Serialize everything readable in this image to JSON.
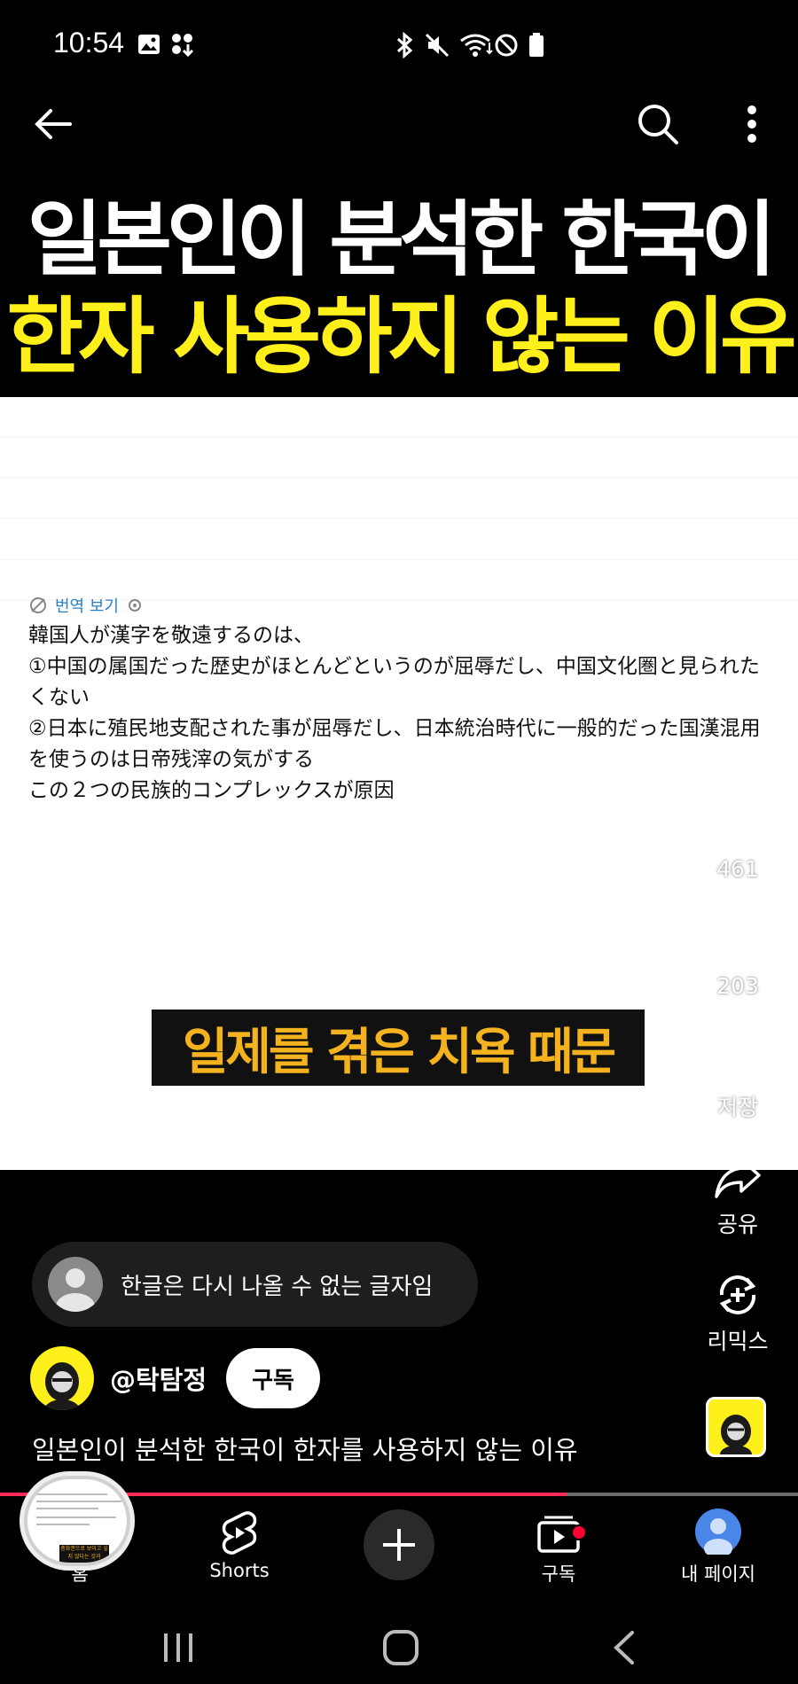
{
  "status_bar": {
    "time": "10:54",
    "left_icons": [
      "image-icon",
      "app-download-icon"
    ],
    "right_icons": [
      "bluetooth-icon",
      "mute-icon",
      "wifi-icon",
      "do-not-disturb-icon",
      "battery-icon"
    ]
  },
  "top_bar": {
    "icons": [
      "back-arrow-icon",
      "search-icon",
      "more-vert-icon"
    ]
  },
  "video": {
    "headline_line1": "일본인이 분석한 한국이",
    "headline_line2": "한자 사용하지 않는 이유",
    "translate_label": "번역 보기",
    "post_lines": [
      "韓国人が漢字を敬遠するのは、",
      "",
      "①中国の属国だった歴史がほとんどというのが屈辱だし、中国文化圏と見られたくない",
      "②日本に殖民地支配された事が屈辱だし、日本統治時代に一般的だった国漢混用を使うのは日帝残滓の気がする",
      "",
      "この２つの民族的コンプレックスが原因"
    ],
    "caption": "일제를 겪은 치욕 때문",
    "colors": {
      "headline_yellow": "#ffef1a",
      "caption_orange": "#f4b21f"
    }
  },
  "actions": {
    "like_count": "461",
    "comment_count": "203",
    "save_label": "저장",
    "share_label": "공유",
    "remix_label": "리믹스"
  },
  "comment": {
    "text": "한글은 다시 나올 수 없는 글자임"
  },
  "channel": {
    "name": "@탁탐정",
    "subscribe_label": "구독"
  },
  "video_title": "일본인이 분석한 한국이 한자를 사용하지 않는 이유",
  "progress": {
    "fraction": 0.71,
    "color": "#ff2d55"
  },
  "mini_player": {
    "caption": "충화권으로 보이고 싶지 않다는 것과"
  },
  "bottom_nav": {
    "items": [
      {
        "label": "홈",
        "icon": "home-icon"
      },
      {
        "label": "Shorts",
        "icon": "shorts-icon"
      },
      {
        "label": "",
        "icon": "create-icon"
      },
      {
        "label": "구독",
        "icon": "subscriptions-icon"
      },
      {
        "label": "내 페이지",
        "icon": "profile-avatar-icon"
      }
    ]
  },
  "system_nav": {
    "icons": [
      "recent-apps-icon",
      "home-button-icon",
      "back-icon"
    ]
  }
}
